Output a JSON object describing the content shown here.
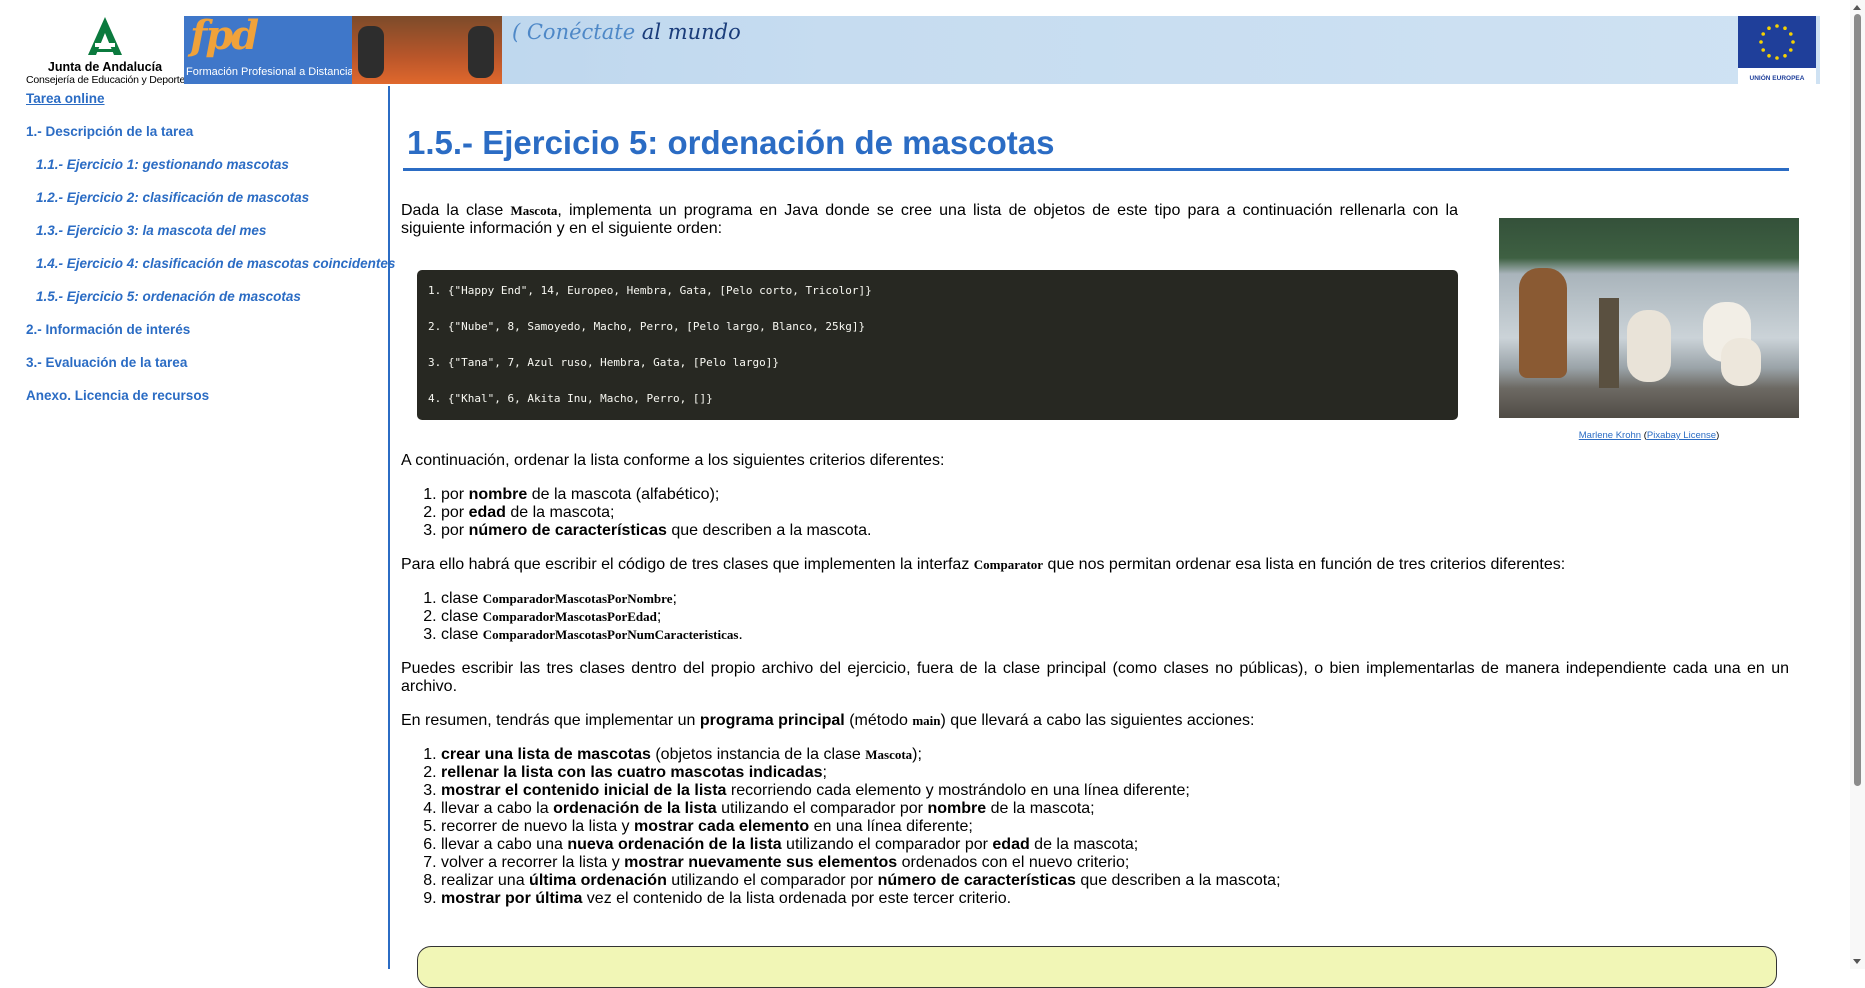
{
  "header": {
    "junta_line1": "Junta de Andalucía",
    "junta_line2": "Consejería de Educación y Deporte",
    "fpd_big": "fpd",
    "fpd_small": "Formación Profesional a Distancia",
    "slogan_pre": "( Conéctate",
    "slogan_post": " al mundo",
    "eu_label": "UNIÓN EUROPEA"
  },
  "sidebar": {
    "home": "Tarea online",
    "items": [
      "1.- Descripción de la tarea",
      "1.1.- Ejercicio 1: gestionando mascotas",
      "1.2.- Ejercicio 2: clasificación de mascotas",
      "1.3.- Ejercicio 3: la mascota del mes",
      "1.4.- Ejercicio 4: clasificación de mascotas coincidentes",
      "1.5.- Ejercicio 5: ordenación de mascotas",
      "2.- Información de interés",
      "3.- Evaluación de la tarea",
      "Anexo. Licencia de recursos"
    ]
  },
  "main": {
    "title": "1.5.- Ejercicio 5: ordenación de mascotas",
    "intro_a": "Dada la clase ",
    "intro_class": "Mascota",
    "intro_b": ", implementa un programa en Java donde se cree una lista de objetos de este tipo para a continuación rellenarla con la siguiente información y en el siguiente orden:",
    "code_lines": [
      "1. {\"Happy End\", 14, Europeo, Hembra, Gata, [Pelo corto, Tricolor]}",
      "2. {\"Nube\", 8, Samoyedo, Macho, Perro, [Pelo largo, Blanco, 25kg]}",
      "3. {\"Tana\", 7, Azul ruso, Hembra, Gata, [Pelo largo]}",
      "4. {\"Khal\", 6, Akita Inu, Macho, Perro, []}"
    ],
    "photo_credit_author": "Marlene Krohn",
    "photo_credit_license": "Pixabay License",
    "criteria_intro": "A continuación, ordenar la lista conforme a los siguientes criterios diferentes:",
    "criteria": [
      {
        "pre": "por ",
        "bold": "nombre",
        "post": " de la mascota (alfabético);"
      },
      {
        "pre": "por ",
        "bold": "edad",
        "post": " de la mascota;"
      },
      {
        "pre": "por ",
        "bold": "número de características",
        "post": " que describen a la mascota."
      }
    ],
    "iface_a": "Para ello habrá que escribir el código de tres clases que implementen la interfaz ",
    "iface_class": "Comparator",
    "iface_b": " que nos permitan ordenar esa lista en función de tres criterios diferentes:",
    "classes": [
      {
        "pre": "clase ",
        "cls": "ComparadorMascotasPorNombre",
        "post": ";"
      },
      {
        "pre": "clase ",
        "cls": "ComparadorMascotasPorEdad",
        "post": ";"
      },
      {
        "pre": "clase ",
        "cls": "ComparadorMascotasPorNumCaracteristicas",
        "post": "."
      }
    ],
    "where_text": "Puedes escribir las tres clases dentro del propio archivo del ejercicio, fuera de la clase principal (como clases no públicas), o bien implementarlas de manera independiente cada una en un archivo.",
    "summary_a": "En resumen, tendrás que implementar un ",
    "summary_bold": "programa principal",
    "summary_b": " (método ",
    "summary_method": "main",
    "summary_c": ") que llevará a cabo las siguientes acciones:",
    "actions": [
      {
        "b1": "crear una lista de mascotas",
        "t1": " (objetos instancia de la clase ",
        "cls": "Mascota",
        "t2": ");"
      },
      {
        "b1": "rellenar la lista con las cuatro mascotas indicadas",
        "t1": ";"
      },
      {
        "b1": "mostrar el contenido inicial de la lista",
        "t1": " recorriendo cada elemento y mostrándolo en una línea diferente;"
      },
      {
        "t0": "llevar a cabo la ",
        "b1": "ordenación de la lista",
        "t1": " utilizando el comparador por ",
        "b2": "nombre",
        "t2": " de la mascota;"
      },
      {
        "t0": "recorrer de nuevo la lista y ",
        "b1": "mostrar cada elemento",
        "t1": " en una línea diferente;"
      },
      {
        "t0": "llevar a cabo una ",
        "b1": "nueva ordenación de la lista",
        "t1": " utilizando el comparador por ",
        "b2": "edad",
        "t2": " de la mascota;"
      },
      {
        "t0": "volver a recorrer la lista y ",
        "b1": "mostrar nuevamente sus elementos",
        "t1": " ordenados con el nuevo criterio;"
      },
      {
        "t0": "realizar una ",
        "b1": "última ordenación",
        "t1": " utilizando el comparador por ",
        "b2": "número de características",
        "t2": " que describen a la mascota;"
      },
      {
        "b1": "mostrar por última",
        "t1": " vez el contenido de la lista ordenada por este tercer criterio."
      }
    ]
  },
  "colors": {
    "accent": "#2b6cc4",
    "code_bg": "#272822",
    "note_bg": "#f1f6b6",
    "fpd_blue": "#3f77c9",
    "andalucia_green": "#0b7a3e"
  }
}
